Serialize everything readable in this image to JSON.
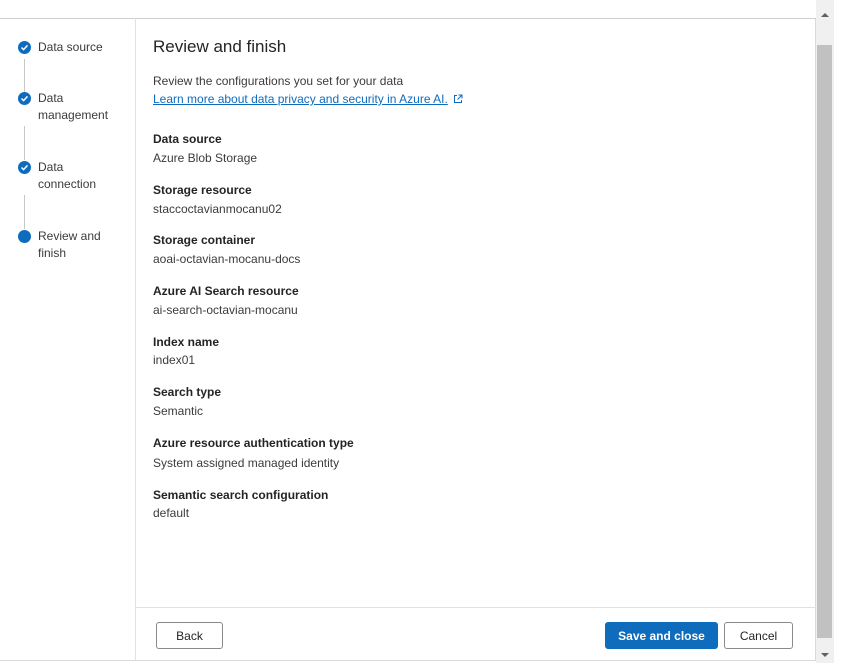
{
  "stepper": {
    "steps": [
      {
        "label_line1": "Data source",
        "label_line2": "",
        "status": "completed"
      },
      {
        "label_line1": "Data",
        "label_line2": "management",
        "status": "completed"
      },
      {
        "label_line1": "Data",
        "label_line2": "connection",
        "status": "completed"
      },
      {
        "label_line1": "Review and",
        "label_line2": "finish",
        "status": "current"
      }
    ]
  },
  "main": {
    "title": "Review and finish",
    "subtitle": "Review the configurations you set for your data",
    "learn_more_link": "Learn more about data privacy and security in Azure AI.",
    "fields": [
      {
        "label": "Data source",
        "value": "Azure Blob Storage"
      },
      {
        "label": "Storage resource",
        "value": "staccoctavianmocanu02"
      },
      {
        "label": "Storage container",
        "value": "aoai-octavian-mocanu-docs"
      },
      {
        "label": "Azure AI Search resource",
        "value": "ai-search-octavian-mocanu"
      },
      {
        "label": "Index name",
        "value": "index01"
      },
      {
        "label": "Search type",
        "value": "Semantic"
      },
      {
        "label": "Azure resource authentication type",
        "value": "System assigned managed identity"
      },
      {
        "label": "Semantic search configuration",
        "value": "default"
      }
    ]
  },
  "footer": {
    "back_label": "Back",
    "save_label": "Save and close",
    "cancel_label": "Cancel"
  },
  "colors": {
    "accent": "#0f6cbd",
    "link": "#0f6cbd"
  },
  "icons": {
    "step_completed": "checkmark-circle-icon",
    "step_current": "filled-circle-icon",
    "external_link": "open-external-icon"
  }
}
